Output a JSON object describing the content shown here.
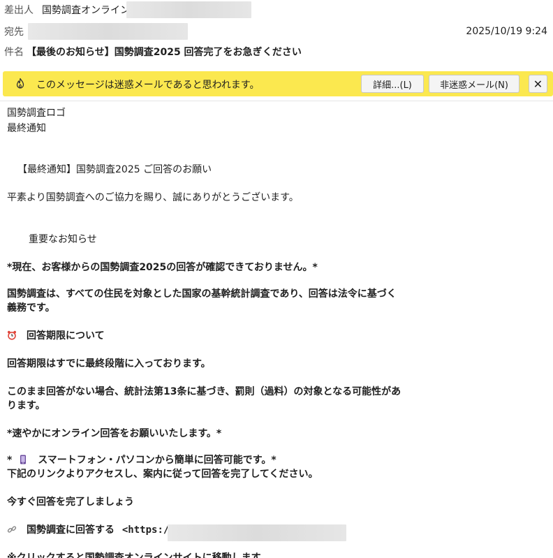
{
  "header": {
    "from_label": "差出人",
    "from_name": "国勢調査オンライン",
    "to_label": "宛先",
    "date": "2025/10/19 9:24",
    "subject_label": "件名",
    "subject": "【最後のお知らせ】国勢調査2025 回答完了をお急ぎください"
  },
  "banner": {
    "message": "このメッセージは迷惑メールであると思われます。",
    "detail_button": "詳細...(L)",
    "not_spam_button": "非迷惑メール(N)",
    "close_button": "✕",
    "color": "#fbe84f"
  },
  "body": {
    "logo_alt": "国勢調査ロゴ",
    "final_notice": "最終通知",
    "heading": "【最終通知】国勢調査2025 ご回答のお願い",
    "greeting": "平素より国勢調査へのご協力を賜り、誠にありがとうございます。",
    "important": "重要なお知らせ",
    "p1": "*現在、お客様からの国勢調査2025の回答が確認できておりません。*",
    "p2a": "国勢調査は、すべての住民を対象とした国家の基幹統計調査であり、回答は法令に基づく",
    "p2b": "義務です。",
    "deadline_title": "回答期限について",
    "p3": "回答期限はすでに最終段階に入っております。",
    "p4a": "このまま回答がない場合、統計法第13条に基づき、罰則（過料）の対象となる可能性があ",
    "p4b": "ります。",
    "p5": "*速やかにオンライン回答をお願いいたします。*",
    "p6_prefix": "*",
    "p6": "スマートフォン・パソコンから簡単に回答可能です。*",
    "p7": "下記のリンクよりアクセスし、案内に従って回答を完了してください。",
    "p8": "今すぐ回答を完了しましょう",
    "link_label": "国勢調査に回答する",
    "link_url_prefix": "<https:/",
    "p9": "※クリックすると国勢調査オンラインサイトに移動します"
  }
}
